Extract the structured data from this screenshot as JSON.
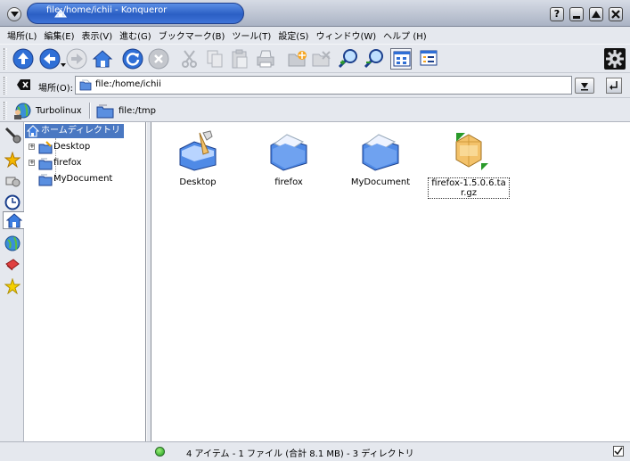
{
  "window": {
    "title": "file:/home/ichii - Konqueror"
  },
  "menubar": {
    "items": [
      "場所(L)",
      "編集(E)",
      "表示(V)",
      "進む(G)",
      "ブックマーク(B)",
      "ツール(T)",
      "設定(S)",
      "ウィンドウ(W)",
      "ヘルプ (H)"
    ]
  },
  "location": {
    "label": "場所(O):",
    "value": "file:/home/ichii"
  },
  "bookmarks": {
    "items": [
      "Turbolinux",
      "file:/tmp"
    ]
  },
  "tree": {
    "root_label": "ホームディレクトリ",
    "items": [
      "Desktop",
      "firefox",
      "MyDocument"
    ]
  },
  "files": {
    "items": [
      {
        "name": "Desktop",
        "icon": "desktop-folder-icon"
      },
      {
        "name": "firefox",
        "icon": "folder-icon"
      },
      {
        "name": "MyDocument",
        "icon": "folder-icon"
      },
      {
        "name": "firefox-1.5.0.6.tar.gz",
        "icon": "archive-icon"
      }
    ]
  },
  "status": {
    "text": "4 アイテム - 1 ファイル (合計 8.1 MB) - 3 ディレクトリ"
  },
  "colors": {
    "accent": "#4a78c2",
    "title_pill": "#2b5fc4"
  }
}
